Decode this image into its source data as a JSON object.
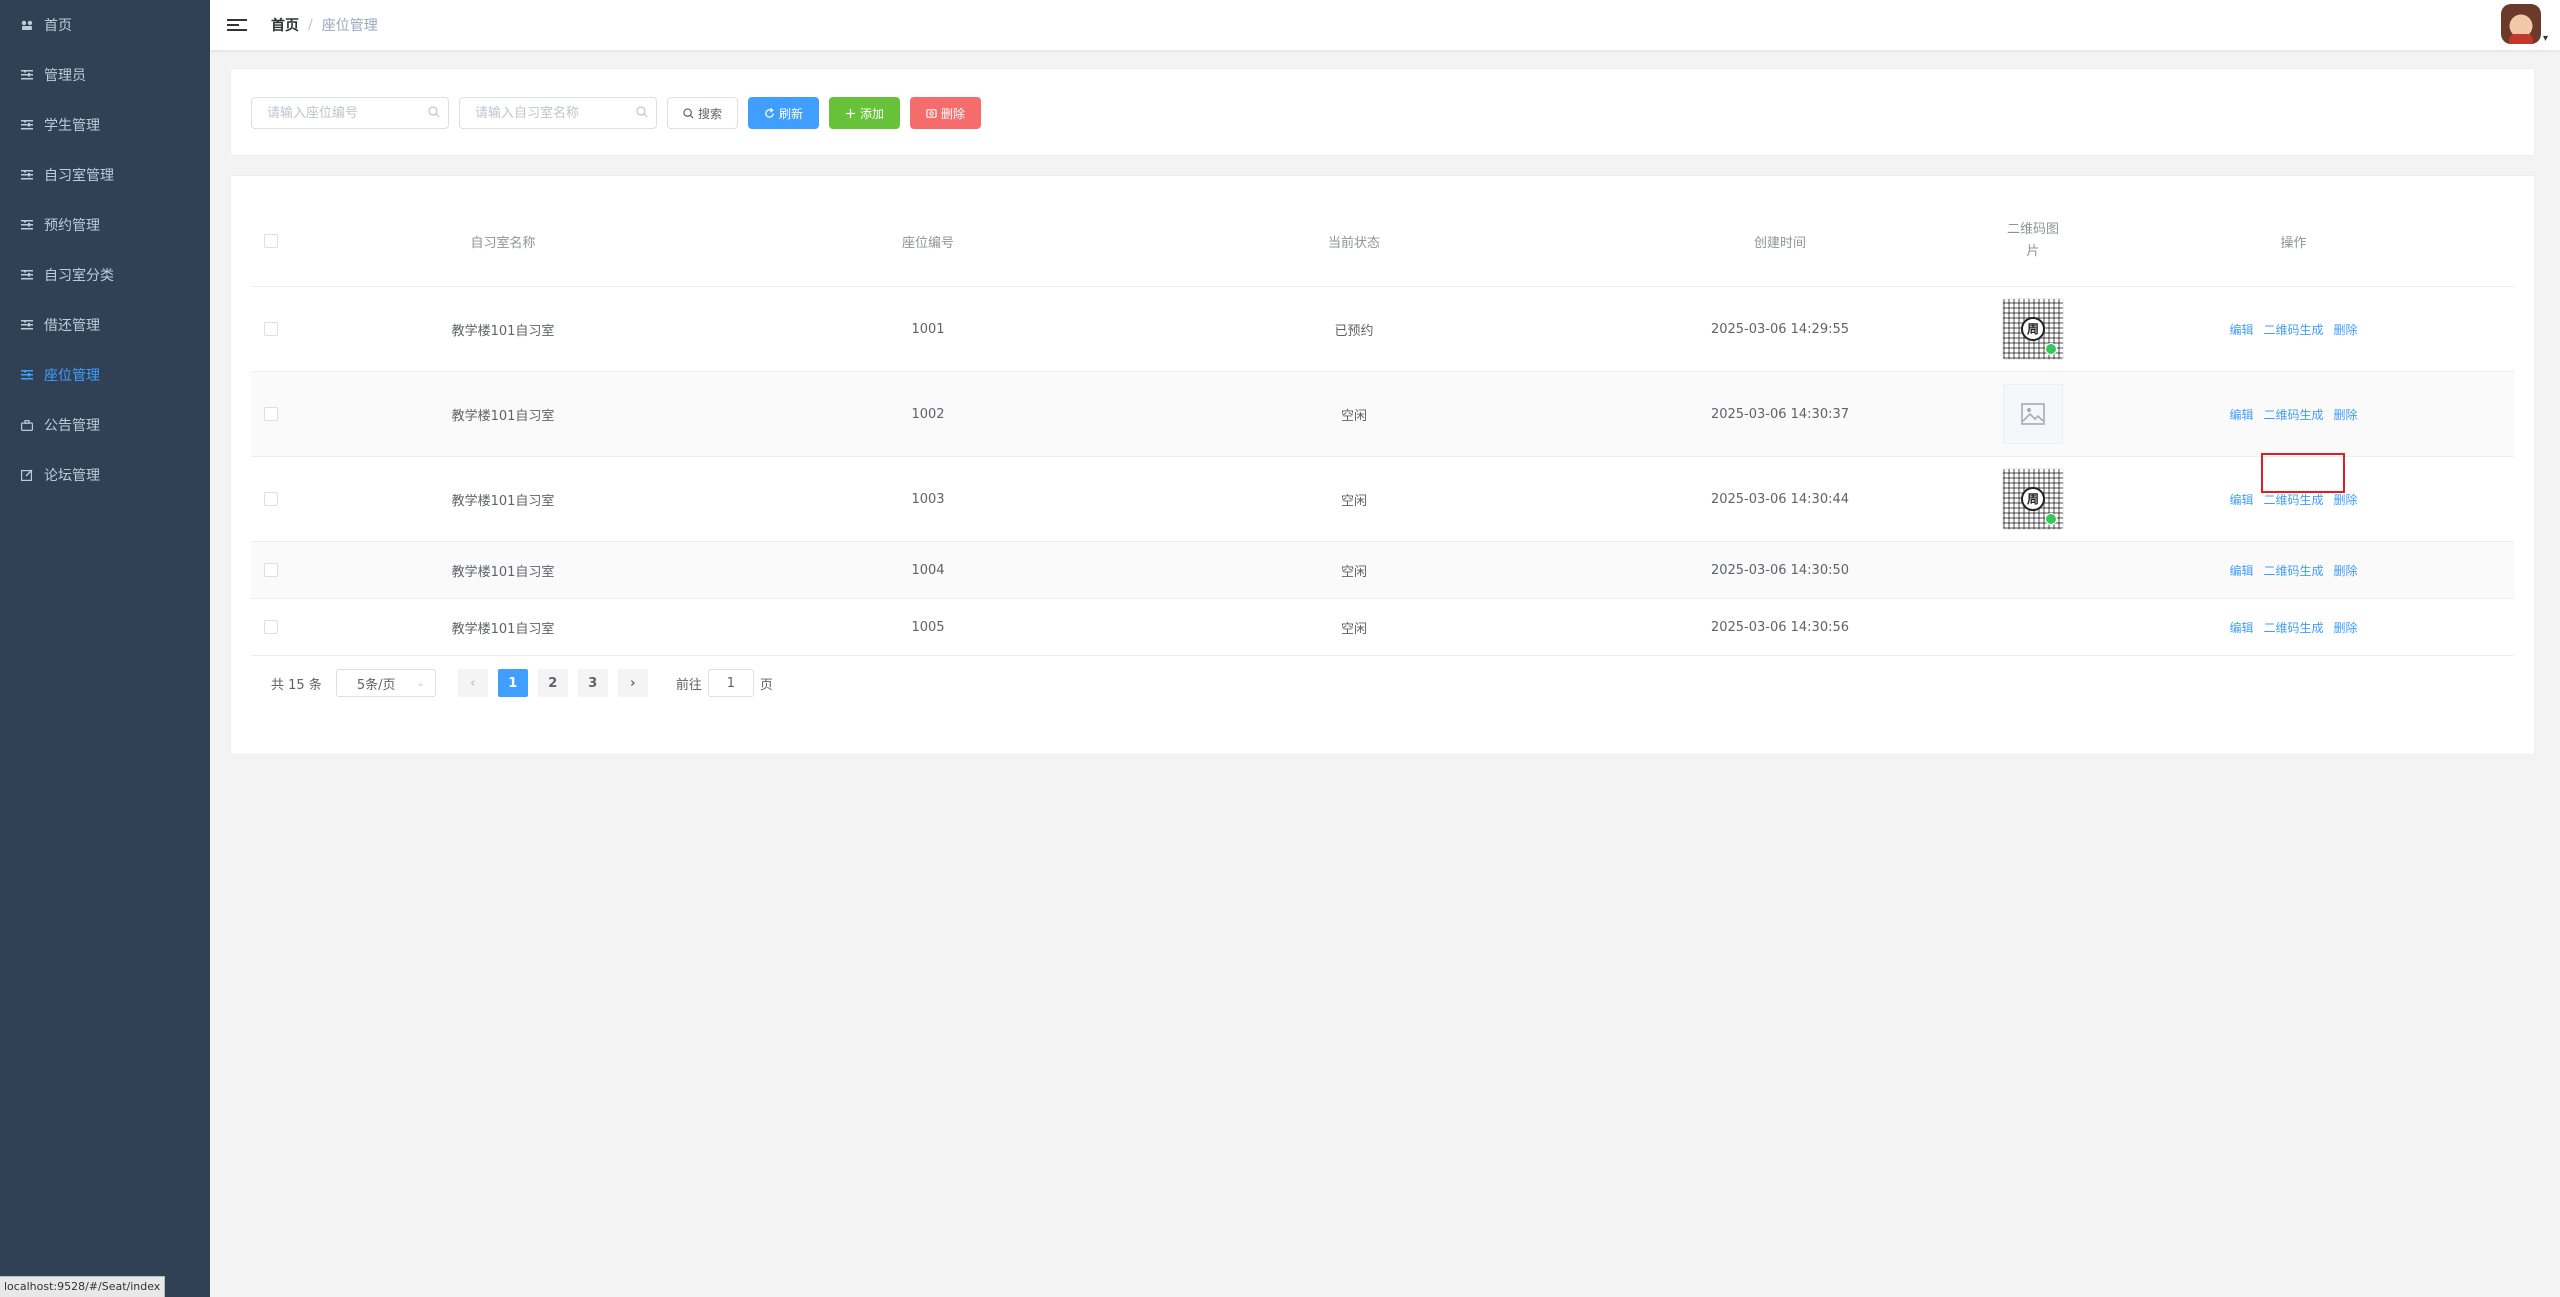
{
  "sidebar": {
    "items": [
      {
        "label": "首页",
        "icon": "dashboard-icon"
      },
      {
        "label": "管理员",
        "icon": "list-icon"
      },
      {
        "label": "学生管理",
        "icon": "list-icon"
      },
      {
        "label": "自习室管理",
        "icon": "list-icon"
      },
      {
        "label": "预约管理",
        "icon": "list-icon"
      },
      {
        "label": "自习室分类",
        "icon": "list-icon"
      },
      {
        "label": "借还管理",
        "icon": "list-icon"
      },
      {
        "label": "座位管理",
        "icon": "list-icon",
        "active": true
      },
      {
        "label": "公告管理",
        "icon": "briefcase-icon"
      },
      {
        "label": "论坛管理",
        "icon": "edit-icon"
      }
    ],
    "status_url": "localhost:9528/#/Seat/index"
  },
  "navbar": {
    "breadcrumb_home": "首页",
    "breadcrumb_sep": "/",
    "breadcrumb_current": "座位管理"
  },
  "search": {
    "seat_placeholder": "请输入座位编号",
    "room_placeholder": "请输入自习室名称",
    "search_label": "搜索",
    "refresh_label": "刷新",
    "add_label": "添加",
    "delete_label": "删除"
  },
  "table": {
    "headers": {
      "room": "自习室名称",
      "seat": "座位编号",
      "status": "当前状态",
      "time": "创建时间",
      "qr_line1": "二维码图",
      "qr_line2": "片",
      "ops": "操作"
    },
    "rows": [
      {
        "room": "教学楼101自习室",
        "seat": "1001",
        "status": "已预约",
        "time": "2025-03-06 14:29:55",
        "qr": "qr-code"
      },
      {
        "room": "教学楼101自习室",
        "seat": "1002",
        "status": "空闲",
        "time": "2025-03-06 14:30:37",
        "qr": "image-placeholder"
      },
      {
        "room": "教学楼101自习室",
        "seat": "1003",
        "status": "空闲",
        "time": "2025-03-06 14:30:44",
        "qr": "qr-code"
      },
      {
        "room": "教学楼101自习室",
        "seat": "1004",
        "status": "空闲",
        "time": "2025-03-06 14:30:50",
        "qr": "none"
      },
      {
        "room": "教学楼101自习室",
        "seat": "1005",
        "status": "空闲",
        "time": "2025-03-06 14:30:56",
        "qr": "none"
      }
    ],
    "ops": {
      "edit": "编辑",
      "qr_gen": "二维码生成",
      "delete": "删除"
    },
    "qr_center_char": "周"
  },
  "pagination": {
    "total": "共 15 条",
    "page_size": "5条/页",
    "pages": [
      "1",
      "2",
      "3"
    ],
    "current": "1",
    "goto_prefix": "前往",
    "goto_value": "1",
    "goto_suffix": "页"
  },
  "colors": {
    "sidebar_bg": "#304156",
    "accent": "#409eff",
    "success": "#67c23a",
    "danger": "#f56c6c",
    "highlight": "#e02020"
  }
}
